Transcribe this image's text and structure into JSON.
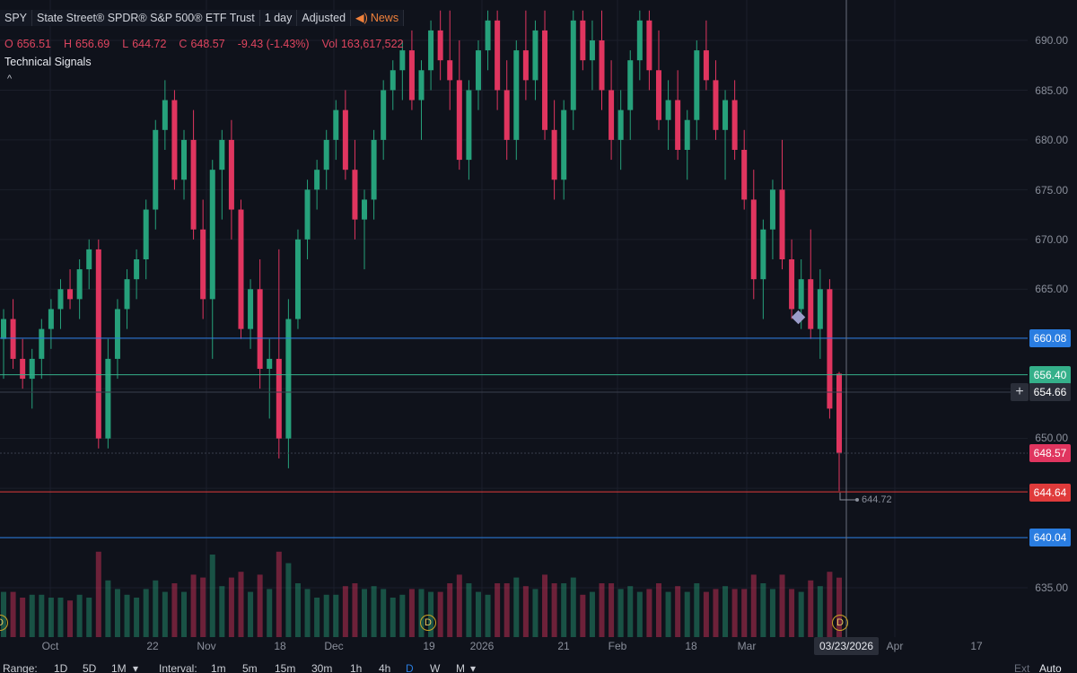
{
  "header": {
    "symbol": "SPY",
    "name": "State Street® SPDR® S&P 500® ETF Trust",
    "interval": "1 day",
    "adjusted": "Adjusted",
    "news": "News"
  },
  "ohlc": {
    "open_label": "O",
    "open": "656.51",
    "high_label": "H",
    "high": "656.69",
    "low_label": "L",
    "low": "644.72",
    "close_label": "C",
    "close": "648.57",
    "change": "-9.43 (-1.43%)",
    "vol_label": "Vol",
    "volume": "163,617,522"
  },
  "indicator_label": "Technical Signals",
  "price_ticks": [
    "690.00",
    "685.00",
    "680.00",
    "675.00",
    "670.00",
    "665.00",
    "650.00",
    "635.00"
  ],
  "badges": {
    "line_blue_upper": "660.08",
    "line_green": "656.40",
    "crosshair_price": "654.66",
    "last_close": "648.57",
    "line_red": "644.64",
    "line_blue_lower": "640.04"
  },
  "low_annotation": "644.72",
  "time_labels": [
    "Oct",
    "22",
    "Nov",
    "18",
    "Dec",
    "19",
    "2026",
    "21",
    "Feb",
    "18",
    "Mar",
    "Apr",
    "17"
  ],
  "crosshair_date": "03/23/2026",
  "dividend_marker": "D",
  "footer": {
    "range_label": "Range:",
    "ranges": [
      "1D",
      "5D",
      "1M"
    ],
    "interval_label": "Interval:",
    "intervals": [
      "1m",
      "5m",
      "15m",
      "30m",
      "1h",
      "4h",
      "D",
      "W",
      "M"
    ],
    "ext": "Ext",
    "auto": "Auto"
  },
  "colors": {
    "up": "#26a17b",
    "down": "#e0355f",
    "blue_line": "#2a7de1",
    "green_line": "#35b08a",
    "red_line": "#e03b3b",
    "background": "#0f121b"
  },
  "chart_data": {
    "type": "candlestick",
    "price_range": [
      630,
      693
    ],
    "candles": [
      {
        "o": 660,
        "h": 663,
        "l": 656,
        "c": 662
      },
      {
        "o": 662,
        "h": 664,
        "l": 657,
        "c": 658
      },
      {
        "o": 658,
        "h": 660,
        "l": 655,
        "c": 656
      },
      {
        "o": 656,
        "h": 659,
        "l": 653,
        "c": 658
      },
      {
        "o": 658,
        "h": 662,
        "l": 656,
        "c": 661
      },
      {
        "o": 661,
        "h": 664,
        "l": 659,
        "c": 663
      },
      {
        "o": 663,
        "h": 666,
        "l": 661,
        "c": 665
      },
      {
        "o": 665,
        "h": 667,
        "l": 663,
        "c": 664
      },
      {
        "o": 664,
        "h": 668,
        "l": 662,
        "c": 667
      },
      {
        "o": 667,
        "h": 670,
        "l": 665,
        "c": 669
      },
      {
        "o": 669,
        "h": 670,
        "l": 649,
        "c": 650
      },
      {
        "o": 650,
        "h": 660,
        "l": 649,
        "c": 658
      },
      {
        "o": 658,
        "h": 664,
        "l": 656,
        "c": 663
      },
      {
        "o": 663,
        "h": 667,
        "l": 661,
        "c": 666
      },
      {
        "o": 666,
        "h": 669,
        "l": 664,
        "c": 668
      },
      {
        "o": 668,
        "h": 674,
        "l": 666,
        "c": 673
      },
      {
        "o": 673,
        "h": 682,
        "l": 671,
        "c": 681
      },
      {
        "o": 681,
        "h": 686,
        "l": 679,
        "c": 684
      },
      {
        "o": 684,
        "h": 685,
        "l": 675,
        "c": 676
      },
      {
        "o": 676,
        "h": 681,
        "l": 674,
        "c": 680
      },
      {
        "o": 680,
        "h": 683,
        "l": 670,
        "c": 671
      },
      {
        "o": 671,
        "h": 674,
        "l": 662,
        "c": 664
      },
      {
        "o": 664,
        "h": 678,
        "l": 658,
        "c": 677
      },
      {
        "o": 677,
        "h": 681,
        "l": 672,
        "c": 680
      },
      {
        "o": 680,
        "h": 682,
        "l": 670,
        "c": 673
      },
      {
        "o": 673,
        "h": 674,
        "l": 660,
        "c": 661
      },
      {
        "o": 661,
        "h": 666,
        "l": 659,
        "c": 665
      },
      {
        "o": 665,
        "h": 668,
        "l": 655,
        "c": 657
      },
      {
        "o": 657,
        "h": 660,
        "l": 652,
        "c": 658
      },
      {
        "o": 658,
        "h": 669,
        "l": 648,
        "c": 650
      },
      {
        "o": 650,
        "h": 664,
        "l": 647,
        "c": 662
      },
      {
        "o": 662,
        "h": 671,
        "l": 661,
        "c": 670
      },
      {
        "o": 670,
        "h": 676,
        "l": 668,
        "c": 675
      },
      {
        "o": 675,
        "h": 678,
        "l": 673,
        "c": 677
      },
      {
        "o": 677,
        "h": 681,
        "l": 675,
        "c": 680
      },
      {
        "o": 680,
        "h": 684,
        "l": 678,
        "c": 683
      },
      {
        "o": 683,
        "h": 685,
        "l": 676,
        "c": 677
      },
      {
        "o": 677,
        "h": 680,
        "l": 670,
        "c": 672
      },
      {
        "o": 672,
        "h": 675,
        "l": 667,
        "c": 674
      },
      {
        "o": 674,
        "h": 681,
        "l": 672,
        "c": 680
      },
      {
        "o": 680,
        "h": 686,
        "l": 678,
        "c": 685
      },
      {
        "o": 685,
        "h": 688,
        "l": 683,
        "c": 687
      },
      {
        "o": 687,
        "h": 690,
        "l": 684,
        "c": 689
      },
      {
        "o": 689,
        "h": 691,
        "l": 683,
        "c": 684
      },
      {
        "o": 684,
        "h": 688,
        "l": 680,
        "c": 687
      },
      {
        "o": 687,
        "h": 692,
        "l": 685,
        "c": 691
      },
      {
        "o": 691,
        "h": 693,
        "l": 686,
        "c": 688
      },
      {
        "o": 688,
        "h": 693,
        "l": 683,
        "c": 686
      },
      {
        "o": 686,
        "h": 690,
        "l": 677,
        "c": 678
      },
      {
        "o": 678,
        "h": 686,
        "l": 676,
        "c": 685
      },
      {
        "o": 685,
        "h": 690,
        "l": 683,
        "c": 689
      },
      {
        "o": 689,
        "h": 693,
        "l": 687,
        "c": 692
      },
      {
        "o": 692,
        "h": 693,
        "l": 683,
        "c": 685
      },
      {
        "o": 685,
        "h": 688,
        "l": 678,
        "c": 680
      },
      {
        "o": 680,
        "h": 690,
        "l": 678,
        "c": 689
      },
      {
        "o": 689,
        "h": 693,
        "l": 684,
        "c": 686
      },
      {
        "o": 686,
        "h": 692,
        "l": 684,
        "c": 691
      },
      {
        "o": 691,
        "h": 693,
        "l": 680,
        "c": 681
      },
      {
        "o": 681,
        "h": 684,
        "l": 674,
        "c": 676
      },
      {
        "o": 676,
        "h": 684,
        "l": 674,
        "c": 683
      },
      {
        "o": 683,
        "h": 693,
        "l": 681,
        "c": 692
      },
      {
        "o": 692,
        "h": 693,
        "l": 687,
        "c": 688
      },
      {
        "o": 688,
        "h": 692,
        "l": 685,
        "c": 690
      },
      {
        "o": 690,
        "h": 693,
        "l": 683,
        "c": 685
      },
      {
        "o": 685,
        "h": 688,
        "l": 678,
        "c": 680
      },
      {
        "o": 680,
        "h": 685,
        "l": 677,
        "c": 683
      },
      {
        "o": 683,
        "h": 689,
        "l": 680,
        "c": 688
      },
      {
        "o": 688,
        "h": 693,
        "l": 686,
        "c": 692
      },
      {
        "o": 692,
        "h": 693,
        "l": 685,
        "c": 687
      },
      {
        "o": 687,
        "h": 691,
        "l": 681,
        "c": 682
      },
      {
        "o": 682,
        "h": 686,
        "l": 679,
        "c": 684
      },
      {
        "o": 684,
        "h": 687,
        "l": 678,
        "c": 679
      },
      {
        "o": 679,
        "h": 683,
        "l": 676,
        "c": 682
      },
      {
        "o": 682,
        "h": 690,
        "l": 680,
        "c": 689
      },
      {
        "o": 689,
        "h": 692,
        "l": 685,
        "c": 686
      },
      {
        "o": 686,
        "h": 688,
        "l": 680,
        "c": 681
      },
      {
        "o": 681,
        "h": 685,
        "l": 676,
        "c": 684
      },
      {
        "o": 684,
        "h": 686,
        "l": 678,
        "c": 679
      },
      {
        "o": 679,
        "h": 681,
        "l": 673,
        "c": 674
      },
      {
        "o": 674,
        "h": 677,
        "l": 664,
        "c": 666
      },
      {
        "o": 666,
        "h": 672,
        "l": 662,
        "c": 671
      },
      {
        "o": 671,
        "h": 676,
        "l": 668,
        "c": 675
      },
      {
        "o": 675,
        "h": 680,
        "l": 667,
        "c": 668
      },
      {
        "o": 668,
        "h": 670,
        "l": 662,
        "c": 663
      },
      {
        "o": 663,
        "h": 668,
        "l": 661,
        "c": 666
      },
      {
        "o": 666,
        "h": 671,
        "l": 660,
        "c": 661
      },
      {
        "o": 661,
        "h": 667,
        "l": 658,
        "c": 665
      },
      {
        "o": 665,
        "h": 666,
        "l": 652,
        "c": 653
      },
      {
        "o": 656.51,
        "h": 656.69,
        "l": 644.72,
        "c": 648.57
      }
    ]
  }
}
